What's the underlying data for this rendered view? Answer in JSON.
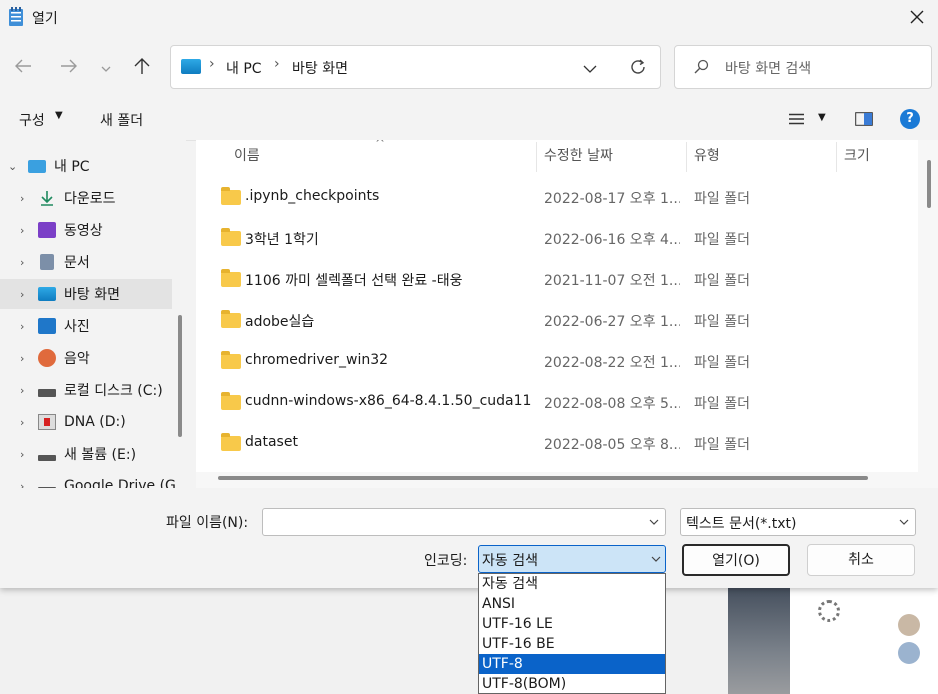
{
  "window": {
    "title": "열기"
  },
  "nav": {
    "breadcrumb": [
      "내 PC",
      "바탕 화면"
    ],
    "search_placeholder": "바탕 화면 검색"
  },
  "toolbar": {
    "organize": "구성",
    "new_folder": "새 폴더"
  },
  "sidebar": {
    "items": [
      {
        "label": "내 PC",
        "icon": "pc-icon"
      },
      {
        "label": "다운로드",
        "icon": "download-icon"
      },
      {
        "label": "동영상",
        "icon": "video-icon"
      },
      {
        "label": "문서",
        "icon": "document-icon"
      },
      {
        "label": "바탕 화면",
        "icon": "desktop-icon"
      },
      {
        "label": "사진",
        "icon": "pictures-icon"
      },
      {
        "label": "음악",
        "icon": "music-icon"
      },
      {
        "label": "로컬 디스크 (C:)",
        "icon": "drive-icon"
      },
      {
        "label": "DNA (D:)",
        "icon": "usb-drive-icon"
      },
      {
        "label": "새 볼륨 (E:)",
        "icon": "drive-icon"
      },
      {
        "label": "Google Drive (G",
        "icon": "drive-icon"
      }
    ]
  },
  "columns": {
    "name": "이름",
    "modified": "수정한 날짜",
    "type": "유형",
    "size": "크기"
  },
  "files": [
    {
      "name": ".ipynb_checkpoints",
      "date": "2022-08-17 오후 1...",
      "type": "파일 폴더"
    },
    {
      "name": "3학년 1학기",
      "date": "2022-06-16 오후 4...",
      "type": "파일 폴더"
    },
    {
      "name": "1106 까미 셀렉폴더 선택 완료 -태웅",
      "date": "2021-11-07 오전 1...",
      "type": "파일 폴더"
    },
    {
      "name": "adobe실습",
      "date": "2022-06-27 오후 1...",
      "type": "파일 폴더"
    },
    {
      "name": "chromedriver_win32",
      "date": "2022-08-22 오전 1...",
      "type": "파일 폴더"
    },
    {
      "name": "cudnn-windows-x86_64-8.4.1.50_cuda11....",
      "date": "2022-08-08 오후 5...",
      "type": "파일 폴더"
    },
    {
      "name": "dataset",
      "date": "2022-08-05 오후 8...",
      "type": "파일 폴더"
    }
  ],
  "footer": {
    "filename_label": "파일 이름(N):",
    "filename_value": "",
    "filetype": "텍스트 문서(*.txt)",
    "encoding_label": "인코딩:",
    "encoding_value": "자동 검색",
    "open": "열기(O)",
    "cancel": "취소"
  },
  "encoding_options": [
    "자동 검색",
    "ANSI",
    "UTF-16 LE",
    "UTF-16 BE",
    "UTF-8",
    "UTF-8(BOM)"
  ],
  "encoding_highlighted": "UTF-8",
  "colors": {
    "accent": "#0a63c9",
    "folder": "#f8c94a",
    "selected_side": "#e3e3e3"
  }
}
